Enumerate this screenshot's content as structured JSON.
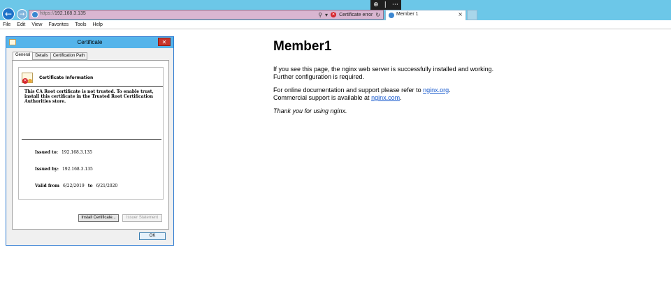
{
  "browser": {
    "url_scheme": "https://",
    "url_host": "192.168.3.135",
    "cert_error_label": "Certificate error",
    "tab_title": "Member 1",
    "zoom_icon": "zoom-icon",
    "more_icon": "more-icon"
  },
  "menu": [
    "File",
    "Edit",
    "View",
    "Favorites",
    "Tools",
    "Help"
  ],
  "page": {
    "heading": "Member1",
    "p1": "If you see this page, the nginx web server is successfully installed and working. Further configuration is required.",
    "p2_prefix": "For online documentation and support please refer to ",
    "p2_link1": "nginx.org",
    "p2_mid": ".",
    "p2_line2_prefix": "Commercial support is available at ",
    "p2_link2": "nginx.com",
    "p2_suffix": ".",
    "p3": "Thank you for using nginx."
  },
  "dialog": {
    "title": "Certificate",
    "tabs": [
      "General",
      "Details",
      "Certification Path"
    ],
    "info_heading": "Certificate Information",
    "warning": "This CA Root certificate is not trusted. To enable trust, install this certificate in the Trusted Root Certification Authorities store.",
    "issued_to_label": "Issued to:",
    "issued_to": "192.168.3.135",
    "issued_by_label": "Issued by:",
    "issued_by": "192.168.3.135",
    "valid_from_label": "Valid from",
    "valid_from": "6/22/2019",
    "valid_to_label": "to",
    "valid_to": "6/21/2020",
    "install_button": "Install Certificate...",
    "issuer_button": "Issuer Statement",
    "ok_button": "OK"
  },
  "colors": {
    "chrome_accent": "#6cc7e8",
    "address_bar_error": "#d9b6d1",
    "link": "#1155cc",
    "dialog_title": "#55b4ea",
    "close_red": "#c7352b"
  }
}
